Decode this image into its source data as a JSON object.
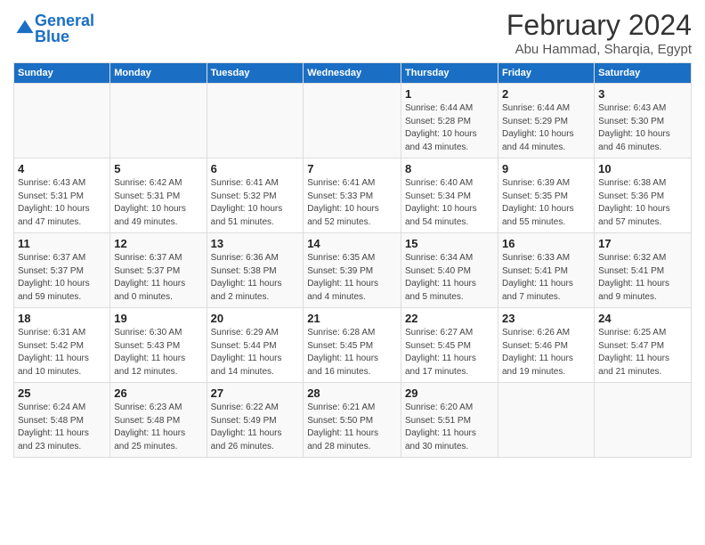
{
  "logo": {
    "line1": "General",
    "line2": "Blue"
  },
  "title": "February 2024",
  "location": "Abu Hammad, Sharqia, Egypt",
  "weekdays": [
    "Sunday",
    "Monday",
    "Tuesday",
    "Wednesday",
    "Thursday",
    "Friday",
    "Saturday"
  ],
  "weeks": [
    [
      {
        "day": "",
        "detail": ""
      },
      {
        "day": "",
        "detail": ""
      },
      {
        "day": "",
        "detail": ""
      },
      {
        "day": "",
        "detail": ""
      },
      {
        "day": "1",
        "detail": "Sunrise: 6:44 AM\nSunset: 5:28 PM\nDaylight: 10 hours\nand 43 minutes."
      },
      {
        "day": "2",
        "detail": "Sunrise: 6:44 AM\nSunset: 5:29 PM\nDaylight: 10 hours\nand 44 minutes."
      },
      {
        "day": "3",
        "detail": "Sunrise: 6:43 AM\nSunset: 5:30 PM\nDaylight: 10 hours\nand 46 minutes."
      }
    ],
    [
      {
        "day": "4",
        "detail": "Sunrise: 6:43 AM\nSunset: 5:31 PM\nDaylight: 10 hours\nand 47 minutes."
      },
      {
        "day": "5",
        "detail": "Sunrise: 6:42 AM\nSunset: 5:31 PM\nDaylight: 10 hours\nand 49 minutes."
      },
      {
        "day": "6",
        "detail": "Sunrise: 6:41 AM\nSunset: 5:32 PM\nDaylight: 10 hours\nand 51 minutes."
      },
      {
        "day": "7",
        "detail": "Sunrise: 6:41 AM\nSunset: 5:33 PM\nDaylight: 10 hours\nand 52 minutes."
      },
      {
        "day": "8",
        "detail": "Sunrise: 6:40 AM\nSunset: 5:34 PM\nDaylight: 10 hours\nand 54 minutes."
      },
      {
        "day": "9",
        "detail": "Sunrise: 6:39 AM\nSunset: 5:35 PM\nDaylight: 10 hours\nand 55 minutes."
      },
      {
        "day": "10",
        "detail": "Sunrise: 6:38 AM\nSunset: 5:36 PM\nDaylight: 10 hours\nand 57 minutes."
      }
    ],
    [
      {
        "day": "11",
        "detail": "Sunrise: 6:37 AM\nSunset: 5:37 PM\nDaylight: 10 hours\nand 59 minutes."
      },
      {
        "day": "12",
        "detail": "Sunrise: 6:37 AM\nSunset: 5:37 PM\nDaylight: 11 hours\nand 0 minutes."
      },
      {
        "day": "13",
        "detail": "Sunrise: 6:36 AM\nSunset: 5:38 PM\nDaylight: 11 hours\nand 2 minutes."
      },
      {
        "day": "14",
        "detail": "Sunrise: 6:35 AM\nSunset: 5:39 PM\nDaylight: 11 hours\nand 4 minutes."
      },
      {
        "day": "15",
        "detail": "Sunrise: 6:34 AM\nSunset: 5:40 PM\nDaylight: 11 hours\nand 5 minutes."
      },
      {
        "day": "16",
        "detail": "Sunrise: 6:33 AM\nSunset: 5:41 PM\nDaylight: 11 hours\nand 7 minutes."
      },
      {
        "day": "17",
        "detail": "Sunrise: 6:32 AM\nSunset: 5:41 PM\nDaylight: 11 hours\nand 9 minutes."
      }
    ],
    [
      {
        "day": "18",
        "detail": "Sunrise: 6:31 AM\nSunset: 5:42 PM\nDaylight: 11 hours\nand 10 minutes."
      },
      {
        "day": "19",
        "detail": "Sunrise: 6:30 AM\nSunset: 5:43 PM\nDaylight: 11 hours\nand 12 minutes."
      },
      {
        "day": "20",
        "detail": "Sunrise: 6:29 AM\nSunset: 5:44 PM\nDaylight: 11 hours\nand 14 minutes."
      },
      {
        "day": "21",
        "detail": "Sunrise: 6:28 AM\nSunset: 5:45 PM\nDaylight: 11 hours\nand 16 minutes."
      },
      {
        "day": "22",
        "detail": "Sunrise: 6:27 AM\nSunset: 5:45 PM\nDaylight: 11 hours\nand 17 minutes."
      },
      {
        "day": "23",
        "detail": "Sunrise: 6:26 AM\nSunset: 5:46 PM\nDaylight: 11 hours\nand 19 minutes."
      },
      {
        "day": "24",
        "detail": "Sunrise: 6:25 AM\nSunset: 5:47 PM\nDaylight: 11 hours\nand 21 minutes."
      }
    ],
    [
      {
        "day": "25",
        "detail": "Sunrise: 6:24 AM\nSunset: 5:48 PM\nDaylight: 11 hours\nand 23 minutes."
      },
      {
        "day": "26",
        "detail": "Sunrise: 6:23 AM\nSunset: 5:48 PM\nDaylight: 11 hours\nand 25 minutes."
      },
      {
        "day": "27",
        "detail": "Sunrise: 6:22 AM\nSunset: 5:49 PM\nDaylight: 11 hours\nand 26 minutes."
      },
      {
        "day": "28",
        "detail": "Sunrise: 6:21 AM\nSunset: 5:50 PM\nDaylight: 11 hours\nand 28 minutes."
      },
      {
        "day": "29",
        "detail": "Sunrise: 6:20 AM\nSunset: 5:51 PM\nDaylight: 11 hours\nand 30 minutes."
      },
      {
        "day": "",
        "detail": ""
      },
      {
        "day": "",
        "detail": ""
      }
    ]
  ]
}
